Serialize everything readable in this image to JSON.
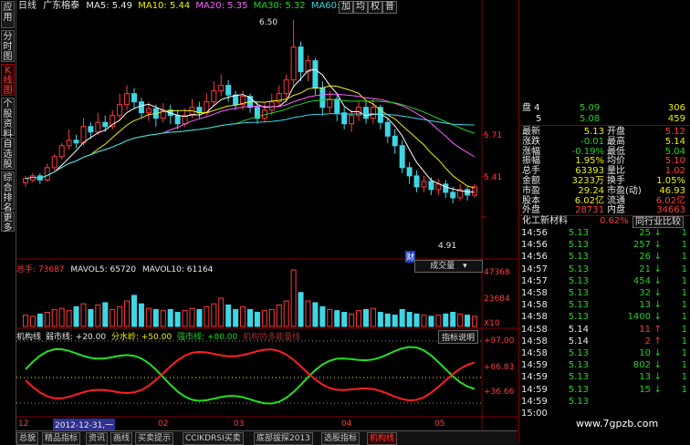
{
  "left_tabs": [
    "应用",
    "分时图",
    "K线图",
    "个股资料",
    "自选股",
    "综合排名",
    "更多"
  ],
  "header": {
    "period": "日线",
    "stock_name": "广东榕泰",
    "ma5": "MA5: 5.49",
    "ma10": "MA10: 5.44",
    "ma20": "MA20: 5.35",
    "ma30": "MA30: 5.32",
    "ma60": "MA60: 5.42",
    "buttons": [
      "加",
      "均",
      "权",
      "普"
    ]
  },
  "price_chart": {
    "high_marker": "6.50",
    "low_marker": "4.91",
    "price_labels": [
      "5.71",
      "5.41"
    ],
    "fin_badge": "财",
    "colors": {
      "up": "#ff3b3b",
      "down": "#3fd6e6",
      "ma5": "#ffffff",
      "ma10": "#f0f000",
      "ma20": "#ff60ff",
      "ma30": "#24d324",
      "ma60": "#3fd6e6"
    },
    "candles": [
      {
        "o": 5.31,
        "c": 5.34,
        "h": 5.36,
        "l": 5.28
      },
      {
        "o": 5.33,
        "c": 5.36,
        "h": 5.38,
        "l": 5.31
      },
      {
        "o": 5.36,
        "c": 5.33,
        "h": 5.38,
        "l": 5.3
      },
      {
        "o": 5.33,
        "c": 5.42,
        "h": 5.45,
        "l": 5.32
      },
      {
        "o": 5.42,
        "c": 5.5,
        "h": 5.52,
        "l": 5.4
      },
      {
        "o": 5.5,
        "c": 5.58,
        "h": 5.6,
        "l": 5.48
      },
      {
        "o": 5.58,
        "c": 5.62,
        "h": 5.7,
        "l": 5.55
      },
      {
        "o": 5.62,
        "c": 5.6,
        "h": 5.66,
        "l": 5.56
      },
      {
        "o": 5.6,
        "c": 5.72,
        "h": 5.78,
        "l": 5.58
      },
      {
        "o": 5.72,
        "c": 5.68,
        "h": 5.75,
        "l": 5.63
      },
      {
        "o": 5.68,
        "c": 5.75,
        "h": 5.82,
        "l": 5.66
      },
      {
        "o": 5.75,
        "c": 5.72,
        "h": 5.8,
        "l": 5.68
      },
      {
        "o": 5.72,
        "c": 5.8,
        "h": 5.84,
        "l": 5.7
      },
      {
        "o": 5.8,
        "c": 5.88,
        "h": 5.96,
        "l": 5.78
      },
      {
        "o": 5.88,
        "c": 5.96,
        "h": 6.02,
        "l": 5.84
      },
      {
        "o": 5.96,
        "c": 5.9,
        "h": 6.0,
        "l": 5.85
      },
      {
        "o": 5.9,
        "c": 5.82,
        "h": 5.93,
        "l": 5.78
      },
      {
        "o": 5.82,
        "c": 5.85,
        "h": 5.9,
        "l": 5.76
      },
      {
        "o": 5.85,
        "c": 5.78,
        "h": 5.88,
        "l": 5.72
      },
      {
        "o": 5.78,
        "c": 5.84,
        "h": 5.89,
        "l": 5.75
      },
      {
        "o": 5.84,
        "c": 5.8,
        "h": 5.88,
        "l": 5.74
      },
      {
        "o": 5.8,
        "c": 5.74,
        "h": 5.84,
        "l": 5.7
      },
      {
        "o": 5.74,
        "c": 5.8,
        "h": 5.85,
        "l": 5.72
      },
      {
        "o": 5.8,
        "c": 5.86,
        "h": 5.92,
        "l": 5.78
      },
      {
        "o": 5.86,
        "c": 5.82,
        "h": 5.9,
        "l": 5.78
      },
      {
        "o": 5.82,
        "c": 5.9,
        "h": 5.96,
        "l": 5.8
      },
      {
        "o": 5.9,
        "c": 5.98,
        "h": 6.05,
        "l": 5.87
      },
      {
        "o": 5.98,
        "c": 6.02,
        "h": 6.1,
        "l": 5.94
      },
      {
        "o": 6.02,
        "c": 5.95,
        "h": 6.06,
        "l": 5.9
      },
      {
        "o": 5.95,
        "c": 5.88,
        "h": 5.98,
        "l": 5.84
      },
      {
        "o": 5.88,
        "c": 5.94,
        "h": 5.98,
        "l": 5.84
      },
      {
        "o": 5.94,
        "c": 5.86,
        "h": 5.96,
        "l": 5.82
      },
      {
        "o": 5.86,
        "c": 5.78,
        "h": 5.9,
        "l": 5.74
      },
      {
        "o": 5.78,
        "c": 5.84,
        "h": 5.9,
        "l": 5.75
      },
      {
        "o": 5.84,
        "c": 5.9,
        "h": 5.96,
        "l": 5.8
      },
      {
        "o": 5.9,
        "c": 5.96,
        "h": 6.02,
        "l": 5.86
      },
      {
        "o": 5.96,
        "c": 6.06,
        "h": 6.1,
        "l": 5.92
      },
      {
        "o": 6.06,
        "c": 6.3,
        "h": 6.5,
        "l": 6.02
      },
      {
        "o": 6.3,
        "c": 6.12,
        "h": 6.34,
        "l": 6.05
      },
      {
        "o": 6.12,
        "c": 6.2,
        "h": 6.24,
        "l": 6.05
      },
      {
        "o": 6.2,
        "c": 6.0,
        "h": 6.22,
        "l": 5.95
      },
      {
        "o": 6.0,
        "c": 5.86,
        "h": 6.05,
        "l": 5.8
      },
      {
        "o": 5.86,
        "c": 5.92,
        "h": 5.98,
        "l": 5.82
      },
      {
        "o": 5.92,
        "c": 5.82,
        "h": 5.95,
        "l": 5.76
      },
      {
        "o": 5.82,
        "c": 5.74,
        "h": 5.86,
        "l": 5.7
      },
      {
        "o": 5.74,
        "c": 5.8,
        "h": 5.84,
        "l": 5.68
      },
      {
        "o": 5.8,
        "c": 5.86,
        "h": 5.9,
        "l": 5.76
      },
      {
        "o": 5.86,
        "c": 5.78,
        "h": 5.9,
        "l": 5.74
      },
      {
        "o": 5.78,
        "c": 5.86,
        "h": 5.92,
        "l": 5.74
      },
      {
        "o": 5.86,
        "c": 5.75,
        "h": 5.88,
        "l": 5.7
      },
      {
        "o": 5.75,
        "c": 5.65,
        "h": 5.78,
        "l": 5.6
      },
      {
        "o": 5.65,
        "c": 5.58,
        "h": 5.7,
        "l": 5.52
      },
      {
        "o": 5.58,
        "c": 5.42,
        "h": 5.62,
        "l": 5.38
      },
      {
        "o": 5.42,
        "c": 5.36,
        "h": 5.46,
        "l": 5.3
      },
      {
        "o": 5.36,
        "c": 5.28,
        "h": 5.4,
        "l": 5.24
      },
      {
        "o": 5.28,
        "c": 5.32,
        "h": 5.36,
        "l": 5.24
      },
      {
        "o": 5.32,
        "c": 5.26,
        "h": 5.35,
        "l": 5.22
      },
      {
        "o": 5.26,
        "c": 5.3,
        "h": 5.34,
        "l": 5.22
      },
      {
        "o": 5.3,
        "c": 5.24,
        "h": 5.33,
        "l": 5.2
      },
      {
        "o": 5.24,
        "c": 5.2,
        "h": 5.28,
        "l": 5.16
      },
      {
        "o": 5.2,
        "c": 5.26,
        "h": 5.3,
        "l": 5.18
      },
      {
        "o": 5.26,
        "c": 5.22,
        "h": 5.28,
        "l": 5.18
      },
      {
        "o": 5.22,
        "c": 5.28,
        "h": 5.3,
        "l": 5.2
      }
    ]
  },
  "volume": {
    "label": "总手: 73687",
    "mavol5": "MAVOL5: 65720",
    "mavol10": "MAVOL10: 61164",
    "dropdown": "成交量",
    "scale": [
      "47368",
      "23684",
      "X10"
    ],
    "bars": [
      0.2,
      0.18,
      0.22,
      0.25,
      0.3,
      0.32,
      0.28,
      0.35,
      0.4,
      0.3,
      0.38,
      0.42,
      0.3,
      0.35,
      0.45,
      0.55,
      0.4,
      0.32,
      0.3,
      0.28,
      0.3,
      0.25,
      0.28,
      0.32,
      0.3,
      0.35,
      0.4,
      0.5,
      0.38,
      0.3,
      0.35,
      0.3,
      0.25,
      0.28,
      0.3,
      0.38,
      0.45,
      1.0,
      0.6,
      0.45,
      0.42,
      0.35,
      0.3,
      0.28,
      0.25,
      0.22,
      0.28,
      0.3,
      0.32,
      0.25,
      0.22,
      0.2,
      0.3,
      0.25,
      0.22,
      0.2,
      0.18,
      0.2,
      0.22,
      0.25,
      0.22,
      0.2,
      0.18
    ]
  },
  "indicator": {
    "name": "机构线",
    "weak_line": "弱市线: +20.00",
    "water_line": "分水岭: +50.00",
    "strong_line": "强市线: +80.00",
    "extra": "机构协多能量线",
    "help_btn": "指标说明",
    "levels": [
      "+97.00",
      "+66.83",
      "+36.66"
    ]
  },
  "x_axis": {
    "labels": [
      "12",
      "2012-12-31,一",
      "02",
      "03",
      "04",
      "05"
    ]
  },
  "bottom_tabs": [
    "总貌",
    "精品指标",
    "资讯",
    "画线",
    "买卖提示",
    "CCIKDRSI买卖",
    "底部拔探2013",
    "选股指标",
    "机构线"
  ],
  "bottom_tab_active": "机构线",
  "quote": {
    "ask_label": "盘 4",
    "ask_price": "5.09",
    "ask_vol": "306",
    "bid_label": "5",
    "bid_price": "5.08",
    "bid_vol": "459",
    "rows": [
      {
        "l": "最新",
        "v": "5.13",
        "l2": "开盘",
        "v2": "5.12"
      },
      {
        "l": "涨跌",
        "v": "-0.01",
        "l2": "最高",
        "v2": "5.14"
      },
      {
        "l": "涨幅",
        "v": "-0.19%",
        "l2": "最低",
        "v2": "5.04"
      },
      {
        "l": "振幅",
        "v": "1.95%",
        "l2": "均价",
        "v2": "5.10"
      },
      {
        "l": "总手",
        "v": "63393",
        "l2": "量比",
        "v2": "1.02"
      },
      {
        "l": "金额",
        "v": "3233万",
        "l2": "换手",
        "v2": "1.05%"
      },
      {
        "l": "市盈",
        "v": "29.24",
        "l2": "市盈(动)",
        "v2": "46.93"
      },
      {
        "l": "股本",
        "v": "6.02亿",
        "l2": "流通",
        "v2": "6.02亿"
      },
      {
        "l": "外盘",
        "v": "28731",
        "l2": "内盘",
        "v2": "34663"
      }
    ],
    "sector": "化工新材料",
    "sector_pct": "0.62%",
    "compare_btn": "同行业比较"
  },
  "ticks": [
    {
      "t": "14:56",
      "p": "5.13",
      "v": "25",
      "d": "down"
    },
    {
      "t": "14:56",
      "p": "5.13",
      "v": "257",
      "d": "down"
    },
    {
      "t": "14:56",
      "p": "5.13",
      "v": "26",
      "d": "down"
    },
    {
      "t": "14:57",
      "p": "5.13",
      "v": "21",
      "d": "down"
    },
    {
      "t": "14:57",
      "p": "5.13",
      "v": "454",
      "d": "down"
    },
    {
      "t": "14:58",
      "p": "5.13",
      "v": "32",
      "d": "down"
    },
    {
      "t": "14:58",
      "p": "5.13",
      "v": "13",
      "d": "down"
    },
    {
      "t": "14:58",
      "p": "5.13",
      "v": "1400",
      "d": "down"
    },
    {
      "t": "14:58",
      "p": "5.14",
      "v": "11",
      "d": "up"
    },
    {
      "t": "14:58",
      "p": "5.14",
      "v": "2",
      "d": "up"
    },
    {
      "t": "14:58",
      "p": "5.13",
      "v": "10",
      "d": "down"
    },
    {
      "t": "14:59",
      "p": "5.13",
      "v": "802",
      "d": "down"
    },
    {
      "t": "14:59",
      "p": "5.13",
      "v": "13",
      "d": "down"
    },
    {
      "t": "14:59",
      "p": "5.13",
      "v": "15",
      "d": "down"
    },
    {
      "t": "14:59",
      "p": "5.13",
      "v": "",
      "d": ""
    },
    {
      "t": "15:00",
      "p": "",
      "v": "",
      "d": ""
    }
  ],
  "watermark": "www.7gpzb.com"
}
